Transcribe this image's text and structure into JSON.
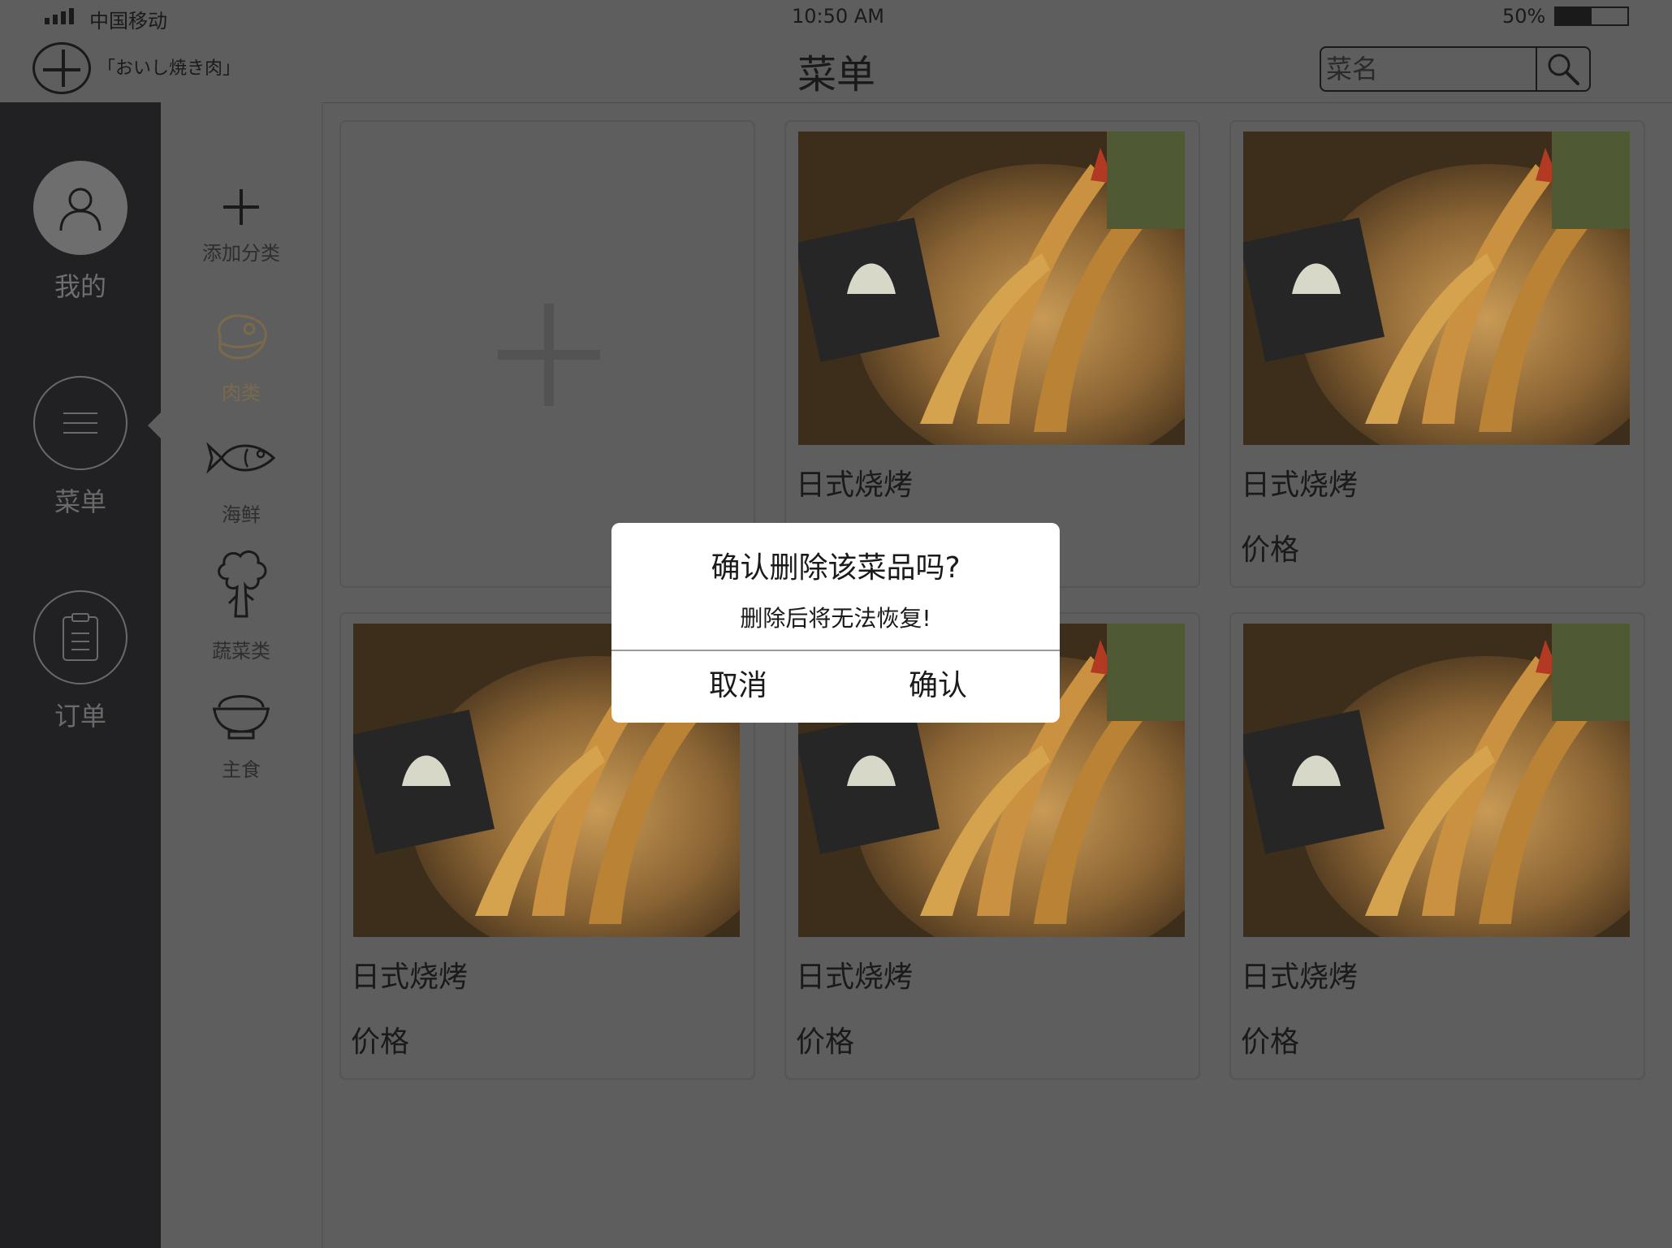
{
  "status_bar": {
    "carrier": "中国移动",
    "time": "10:50 AM",
    "battery_percent_text": "50%",
    "battery_level": 0.5
  },
  "logo": {
    "text": "「おいし焼き肉」"
  },
  "header": {
    "title": "菜单",
    "search": {
      "placeholder": "菜名",
      "icon": "search-icon"
    }
  },
  "nav": {
    "items": [
      {
        "label": "我的",
        "icon": "user-icon"
      },
      {
        "label": "菜单",
        "icon": "menu-lines-icon",
        "active": true
      },
      {
        "label": "订单",
        "icon": "clipboard-icon"
      }
    ]
  },
  "categories": {
    "add_label": "添加分类",
    "items": [
      {
        "label": "肉类",
        "icon": "meat-icon",
        "active": true
      },
      {
        "label": "海鲜",
        "icon": "fish-icon"
      },
      {
        "label": "蔬菜类",
        "icon": "broccoli-icon"
      },
      {
        "label": "主食",
        "icon": "rice-bowl-icon"
      }
    ]
  },
  "dishes": [
    {
      "name": "日式烧烤",
      "price_label": "价格"
    },
    {
      "name": "日式烧烤",
      "price_label": "价格"
    },
    {
      "name": "日式烧烤",
      "price_label": "价格"
    },
    {
      "name": "日式烧烤",
      "price_label": "价格"
    },
    {
      "name": "日式烧烤",
      "price_label": "价格"
    }
  ],
  "dialog": {
    "title": "确认删除该菜品吗?",
    "message": "删除后将无法恢复!",
    "cancel_label": "取消",
    "confirm_label": "确认"
  },
  "colors": {
    "background": "#5e5e5e",
    "nav_background": "#212124",
    "text": "#1a1a1a",
    "placeholder": "#999999",
    "dialog_background": "#ffffff"
  }
}
